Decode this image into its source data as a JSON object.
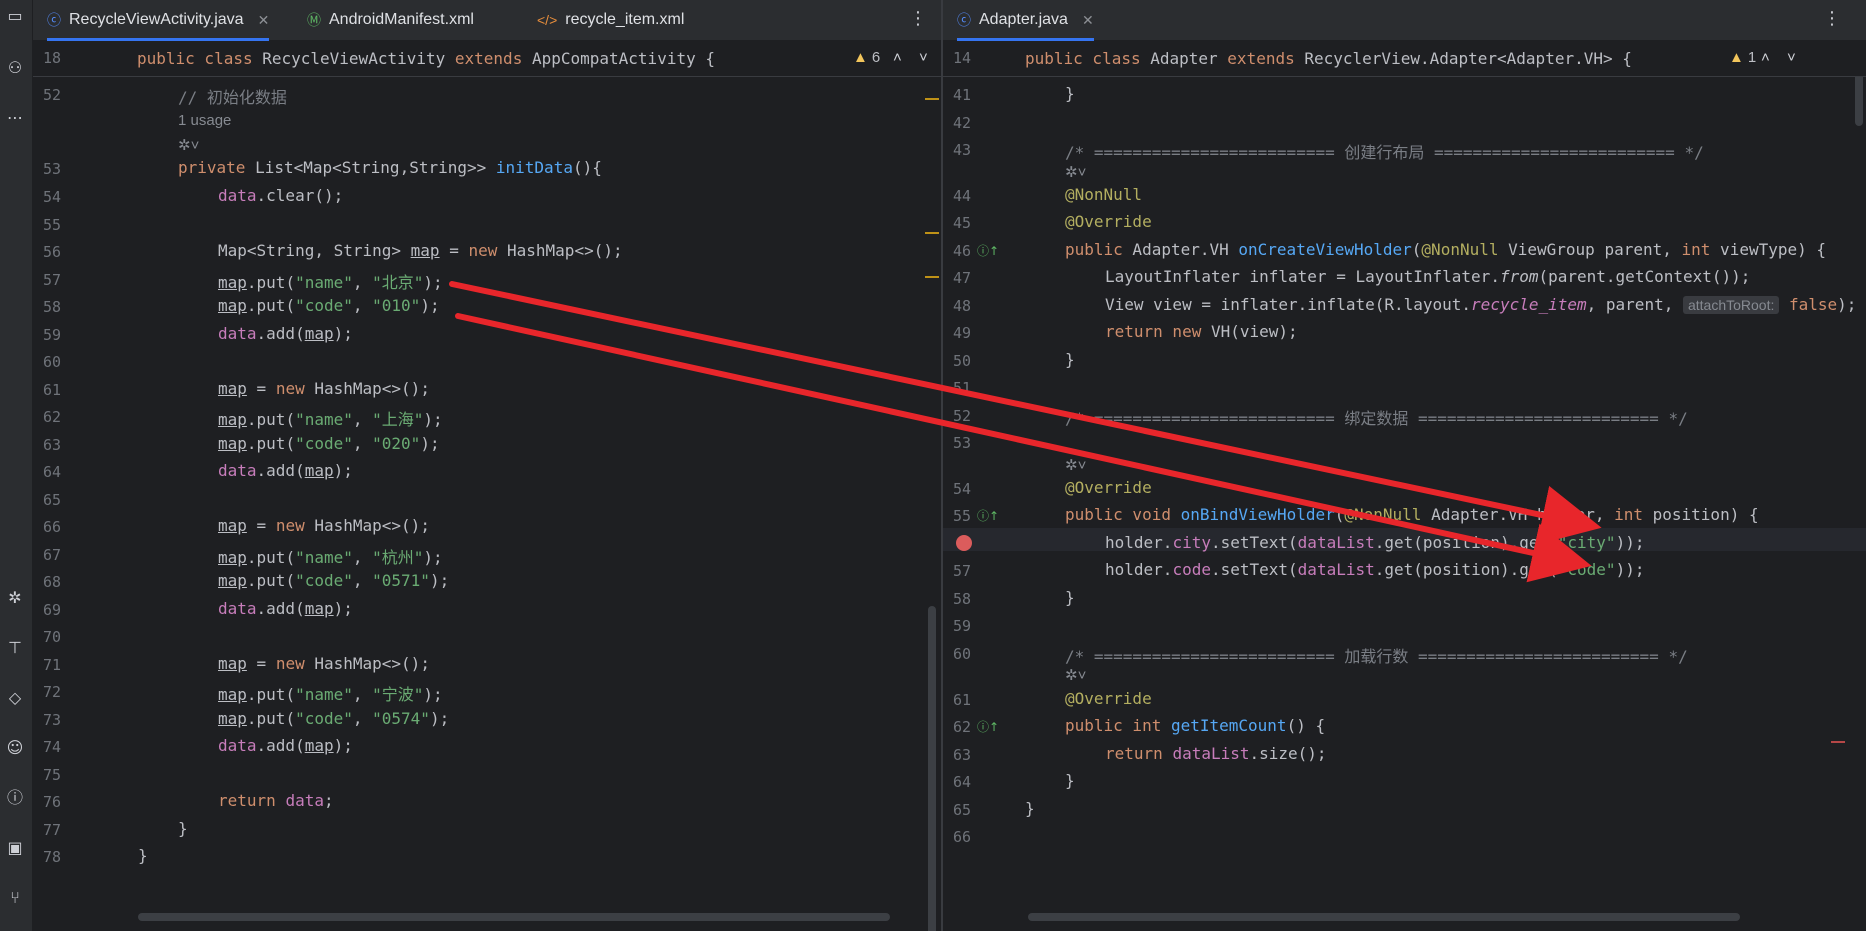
{
  "left_tabs": [
    {
      "label": "RecycleViewActivity.java",
      "icon": "java-class-icon",
      "active": true
    },
    {
      "label": "AndroidManifest.xml",
      "icon": "manifest-icon",
      "active": false
    },
    {
      "label": "recycle_item.xml",
      "icon": "xml-icon",
      "active": false
    }
  ],
  "right_tabs": [
    {
      "label": "Adapter.java",
      "icon": "java-class-icon",
      "active": true
    }
  ],
  "left_sticky": {
    "line": "18",
    "warnings": "6"
  },
  "right_sticky": {
    "line": "14",
    "warnings": "1"
  },
  "left_lines": [
    {
      "n": "52"
    },
    {
      "n": "53"
    },
    {
      "n": "54"
    },
    {
      "n": "55"
    },
    {
      "n": "56"
    },
    {
      "n": "57"
    },
    {
      "n": "58"
    },
    {
      "n": "59"
    },
    {
      "n": "60"
    },
    {
      "n": "61"
    },
    {
      "n": "62"
    },
    {
      "n": "63"
    },
    {
      "n": "64"
    },
    {
      "n": "65"
    },
    {
      "n": "66"
    },
    {
      "n": "67"
    },
    {
      "n": "68"
    },
    {
      "n": "69"
    },
    {
      "n": "70"
    },
    {
      "n": "71"
    },
    {
      "n": "72"
    },
    {
      "n": "73"
    },
    {
      "n": "74"
    },
    {
      "n": "75"
    },
    {
      "n": "76"
    },
    {
      "n": "77"
    },
    {
      "n": "78"
    }
  ],
  "right_lines": [
    {
      "n": "41"
    },
    {
      "n": "42"
    },
    {
      "n": "43"
    },
    {
      "n": "44"
    },
    {
      "n": "45"
    },
    {
      "n": "46"
    },
    {
      "n": "47"
    },
    {
      "n": "48"
    },
    {
      "n": "49"
    },
    {
      "n": "50"
    },
    {
      "n": "51"
    },
    {
      "n": "52"
    },
    {
      "n": "53"
    },
    {
      "n": "54"
    },
    {
      "n": "55"
    },
    {
      "n": "56"
    },
    {
      "n": "57"
    },
    {
      "n": "58"
    },
    {
      "n": "59"
    },
    {
      "n": "60"
    },
    {
      "n": "61"
    },
    {
      "n": "62"
    },
    {
      "n": "63"
    },
    {
      "n": "64"
    },
    {
      "n": "65"
    },
    {
      "n": "66"
    }
  ],
  "hints": {
    "usage": "1 usage",
    "attach_to_root": "attachToRoot:"
  },
  "colors": {
    "keyword": "#cf8e6d",
    "function": "#56a8f5",
    "string": "#6aab73",
    "field": "#c77dbb",
    "annotation": "#b3ae60",
    "comment": "#7a7e85",
    "arrow": "#e8262b",
    "breakpoint": "#db5c5c"
  }
}
